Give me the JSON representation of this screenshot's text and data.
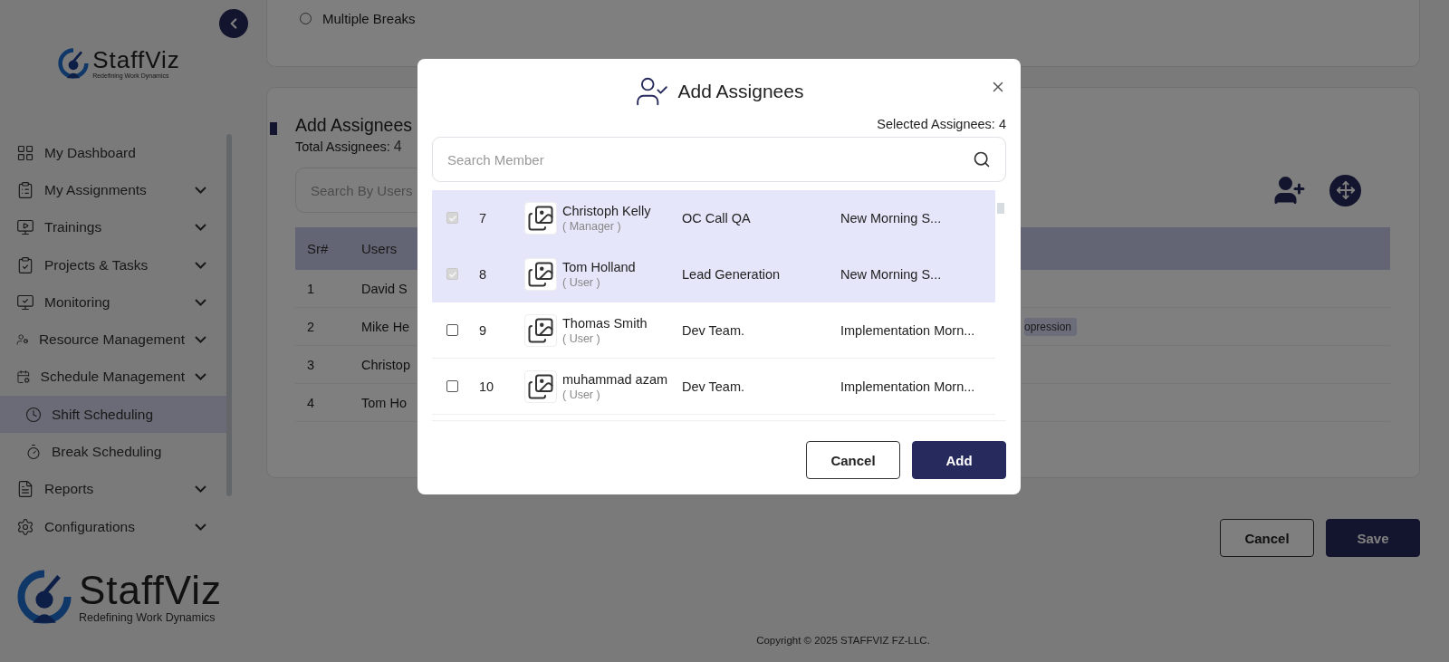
{
  "sidebar": {
    "logo": {
      "name": "StaffViz",
      "tagline": "Redefining Work Dynamics"
    },
    "items": [
      {
        "label": "My Dashboard",
        "expandable": false,
        "selected": false
      },
      {
        "label": "My Assignments",
        "expandable": true,
        "selected": false
      },
      {
        "label": "Trainings",
        "expandable": true,
        "selected": false
      },
      {
        "label": "Projects & Tasks",
        "expandable": true,
        "selected": false
      },
      {
        "label": "Monitoring",
        "expandable": true,
        "selected": false
      },
      {
        "label": "Resource Management",
        "expandable": true,
        "selected": false
      },
      {
        "label": "Schedule Management",
        "expandable": true,
        "selected": false,
        "children": [
          {
            "label": "Shift Scheduling",
            "selected": true
          },
          {
            "label": "Break Scheduling",
            "selected": false
          }
        ]
      },
      {
        "label": "Reports",
        "expandable": true,
        "selected": false
      },
      {
        "label": "Configurations",
        "expandable": true,
        "selected": false
      }
    ],
    "footer_logo": {
      "name": "StaffViz",
      "tagline": "Redefining Work Dynamics"
    }
  },
  "break_options": [
    {
      "label": "Multiple Breaks",
      "selected": false
    }
  ],
  "assignees": {
    "title": "Add Assignees",
    "total_label": "Total Assignees:",
    "total": "4",
    "search": {
      "placeholder": "Search By Users"
    },
    "columns": [
      "Sr#",
      "Users"
    ],
    "rows": [
      {
        "sr": "1",
        "user": "David S"
      },
      {
        "sr": "2",
        "user": "Mike He",
        "tag": "opression"
      },
      {
        "sr": "3",
        "user": "Christop"
      },
      {
        "sr": "4",
        "user": "Tom Ho",
        "tag": ""
      }
    ]
  },
  "form_buttons": [
    "Cancel",
    "Save"
  ],
  "copyright": "Copyright © 2025 STAFFVIZ FZ-LLC.",
  "modal": {
    "title": "Add Assignees",
    "selected_label": "Selected Assignees: 4",
    "search": {
      "placeholder": "Search Member"
    },
    "members": [
      {
        "checked": true,
        "disabled": true,
        "number": "7",
        "name": "Christoph Kelly",
        "role": "( Manager )",
        "team": "OC Call QA",
        "shift": "New Morning S..."
      },
      {
        "checked": true,
        "disabled": true,
        "number": "8",
        "name": "Tom Holland",
        "role": "( User )",
        "team": "Lead Generation",
        "shift": "New Morning S..."
      },
      {
        "checked": false,
        "disabled": false,
        "number": "9",
        "name": "Thomas Smith",
        "role": "( User )",
        "team": "Dev Team.",
        "shift": "Implementation Morn..."
      },
      {
        "checked": false,
        "disabled": false,
        "number": "10",
        "name": "muhammad azam",
        "role": "( User )",
        "team": "Dev Team.",
        "shift": "Implementation Morn..."
      }
    ],
    "buttons": [
      "Cancel",
      "Add"
    ]
  }
}
